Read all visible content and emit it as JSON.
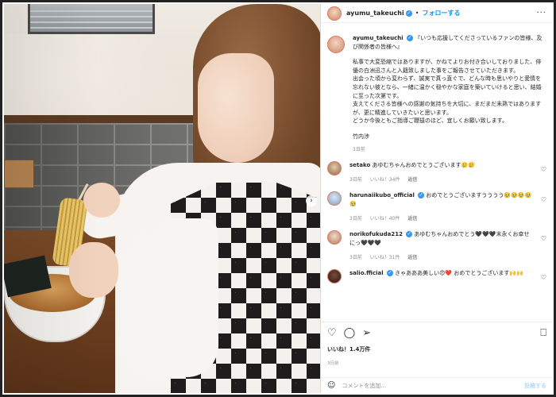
{
  "header": {
    "username": "ayumu_takeuchi",
    "separator": "•",
    "follow_label": "フォローする",
    "more_label": "···"
  },
  "photo": {
    "next_label": "›"
  },
  "caption": {
    "username": "ayumu_takeuchi",
    "title": "『いつも応援してくださっているファンの皆様、及び関係者の皆様へ』",
    "body": "私事で大変恐縮ではありますが、かねてよりお付き合いしておりました、俳優の白洲迅さんと入籍致しました事をご報告させていただきます。\n出会った頃から変わらず、誠実で真っ直ぐで、どんな時も思いやりと愛情を忘れない彼となら、一緒に温かく穏やかな家庭を築いていけると思い、結婚に至った次第です。\n支えてくださる皆様への感謝の気持ちを大切に、まだまだ未熟ではありますが、更に精進していきたいと思います。\nどうか今後ともご指導ご鞭撻のほど、宜しくお願い致します。",
    "signature": "竹内渉",
    "time": "3日前"
  },
  "comments": [
    {
      "username": "setako",
      "verified": false,
      "text": "あゆむちゃんおめでとうございます🥲🥲",
      "time": "3日前",
      "likes": "いいね！34件",
      "reply": "返信"
    },
    {
      "username": "harunaiikubo_official",
      "verified": true,
      "text": "おめでとうございますうううう🥹🥹🥹🥹🥹",
      "time": "3日前",
      "likes": "いいね！40件",
      "reply": "返信"
    },
    {
      "username": "norikofukuda212",
      "verified": true,
      "text": "あゆむちゃんおめでとう🖤🖤🖤末永くお幸せにっ🖤🖤🖤",
      "time": "3日前",
      "likes": "いいね！31件",
      "reply": "返信"
    },
    {
      "username": "salio.fficial",
      "verified": true,
      "text": "きゃあああ美しい😍❤️ おめでとうございます🙌🙌",
      "time": "",
      "likes": "",
      "reply": ""
    }
  ],
  "actions": {
    "like_icon": "heart-icon",
    "comment_icon": "comment-icon",
    "share_icon": "share-icon",
    "save_icon": "bookmark-icon",
    "likes_text": "いいね！1.4万件",
    "date_text": "3日前"
  },
  "comment_box": {
    "emoji_icon": "smiley-icon",
    "placeholder": "コメントを追加...",
    "post_label": "投稿する"
  },
  "colors": {
    "link_blue": "#0095f6",
    "verified_blue": "#3897f0",
    "muted_gray": "#8e8e8e",
    "post_disabled": "#b3dbff"
  }
}
